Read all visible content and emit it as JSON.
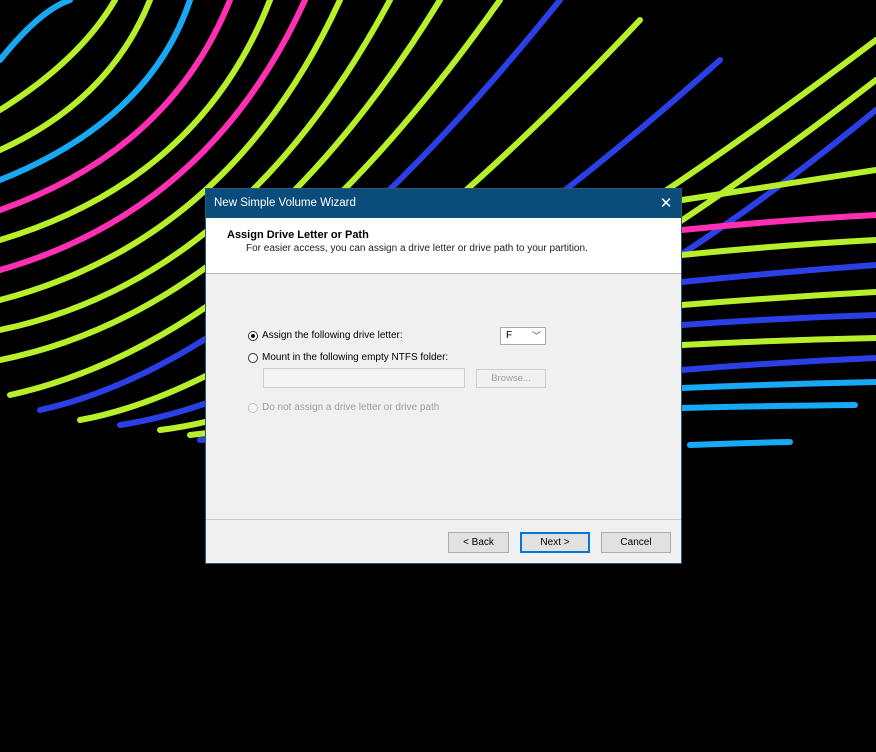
{
  "dialog": {
    "title": "New Simple Volume Wizard",
    "close_glyph": "✕",
    "header_title": "Assign Drive Letter or Path",
    "header_subtitle": "For easier access, you can assign a drive letter or drive path to your partition."
  },
  "options": {
    "assign_letter": {
      "label": "Assign the following drive letter:",
      "selected": true
    },
    "mount_folder": {
      "label": "Mount in the following empty NTFS folder:",
      "selected": false
    },
    "no_assign": {
      "label": "Do not assign a drive letter or drive path",
      "selected": false,
      "disabled": true
    }
  },
  "drive_letter": {
    "value": "F",
    "arrow_glyph": "﹀"
  },
  "folder_path": {
    "value": ""
  },
  "buttons": {
    "browse": "Browse...",
    "back": "< Back",
    "next": "Next >",
    "cancel": "Cancel"
  },
  "colors": {
    "titlebar": "#0a4d7a",
    "dialog_bg": "#f0f0f0",
    "accent": "#0078d7",
    "wallpaper_lines": [
      "#b7f02a",
      "#ff2fb4",
      "#2b3fe6",
      "#17a9f5"
    ]
  },
  "icons": {
    "close": "close-icon",
    "dropdown": "chevron-down-icon"
  }
}
